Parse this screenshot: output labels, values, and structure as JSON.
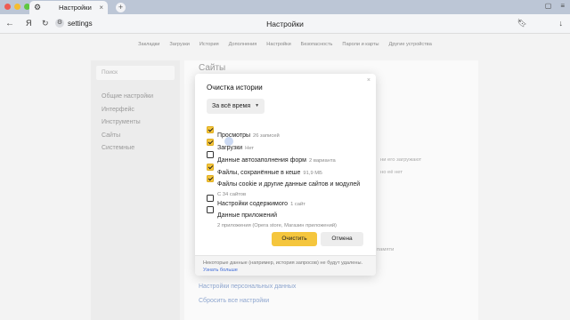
{
  "browser": {
    "tab_title": "Настройки",
    "new_tab": "+",
    "url": "settings",
    "page_title": "Настройки",
    "ya_logo": "Я"
  },
  "settings_nav": [
    "Закладки",
    "Загрузки",
    "История",
    "Дополнения",
    "Настройки",
    "Безопасность",
    "Пароли и карты",
    "Другие устройства"
  ],
  "sidebar": {
    "search_placeholder": "Поиск",
    "items": [
      "Общие настройки",
      "Интерфейс",
      "Инструменты",
      "Сайты",
      "Системные"
    ]
  },
  "main": {
    "title": "Сайты",
    "ghost_lines": [
      "ни его загружают",
      "но её нет",
      "памяти"
    ],
    "links": [
      "Настройки персональных данных",
      "Сбросить все настройки"
    ]
  },
  "dialog": {
    "title": "Очистка истории",
    "close": "×",
    "period": "За всё время",
    "options": [
      {
        "label": "Просмотры",
        "meta": "26 записей",
        "sub": "",
        "checked": true
      },
      {
        "label": "Загрузки",
        "meta": "Нет",
        "sub": "",
        "checked": true
      },
      {
        "label": "Данные автозаполнения форм",
        "meta": "2 варианта",
        "sub": "",
        "checked": false
      },
      {
        "label": "Файлы, сохранённые в кеше",
        "meta": "91,9 МБ",
        "sub": "",
        "checked": true
      },
      {
        "label": "Файлы cookie и другие данные сайтов и модулей",
        "meta": "",
        "sub": "С 34 сайтов",
        "checked": true
      },
      {
        "label": "Настройки содержимого",
        "meta": "1 сайт",
        "sub": "",
        "checked": false
      },
      {
        "label": "Данные приложений",
        "meta": "",
        "sub": "2 приложения (Opera store, Магазин приложений)",
        "checked": false
      }
    ],
    "clear_button": "Очистить",
    "cancel_button": "Отмена",
    "footer_text": "Некоторые данные (например, история запросов) не будут удалены.",
    "footer_link": "Узнать больше"
  },
  "colors": {
    "accent": "#f5c63d",
    "link": "#3f6bd8",
    "tabbar": "#bcc6d6"
  },
  "icons": {
    "settings_tab": "gear-icon",
    "back": "arrow-left-icon",
    "reload": "reload-icon",
    "bookmark": "bookmark-icon",
    "downloads": "download-icon"
  }
}
